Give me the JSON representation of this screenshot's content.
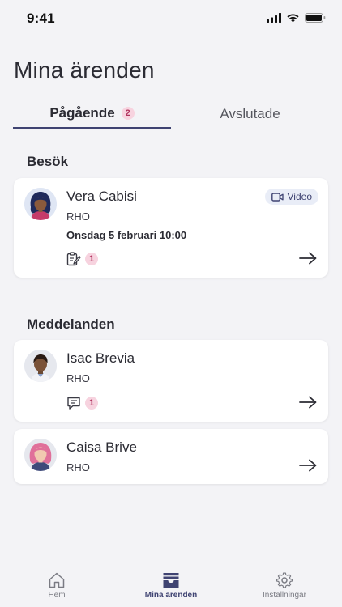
{
  "status_bar": {
    "time": "9:41"
  },
  "page": {
    "title": "Mina ärenden"
  },
  "tabs": [
    {
      "label": "Pågående",
      "badge": "2",
      "active": true
    },
    {
      "label": "Avslutade",
      "active": false
    }
  ],
  "sections": {
    "visits": {
      "heading": "Besök",
      "items": [
        {
          "name": "Vera Cabisi",
          "unit": "RHO",
          "datetime": "Onsdag 5 februari 10:00",
          "type_label": "Video",
          "type_icon": "video-camera-icon",
          "meta_icon": "form-icon",
          "meta_count": "1"
        }
      ]
    },
    "messages": {
      "heading": "Meddelanden",
      "items": [
        {
          "name": "Isac Brevia",
          "unit": "RHO",
          "meta_icon": "chat-bubble-icon",
          "meta_count": "1"
        },
        {
          "name": "Caisa Brive",
          "unit": "RHO"
        }
      ]
    }
  },
  "bottom_nav": [
    {
      "label": "Hem",
      "icon": "home-icon",
      "active": false
    },
    {
      "label": "Mina ärenden",
      "icon": "inbox-icon",
      "active": true
    },
    {
      "label": "Inställningar",
      "icon": "gear-icon",
      "active": false
    }
  ],
  "colors": {
    "accent": "#3f4372",
    "badge_bg": "#f7d3df",
    "badge_text": "#b0325e",
    "background": "#f3f3f6"
  }
}
